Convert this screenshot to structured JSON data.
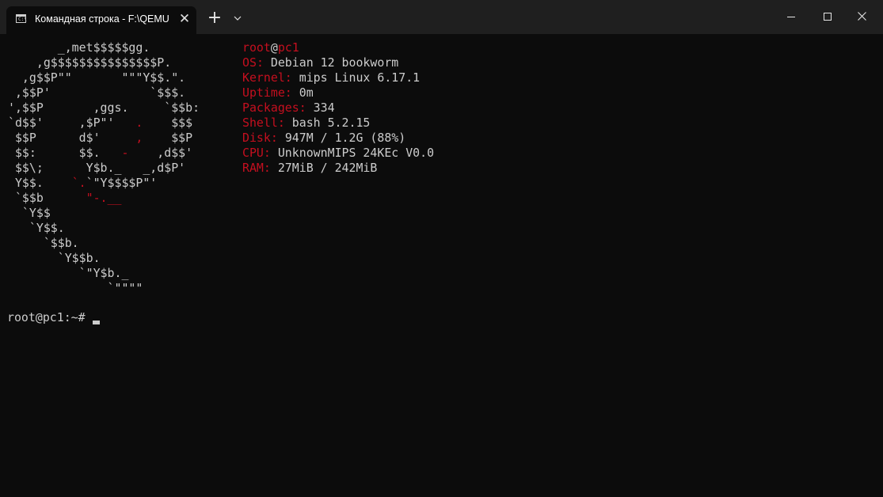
{
  "window": {
    "tab_title": "Командная строка - F:\\QEMU",
    "tab_icon_glyph": "C:\\",
    "tab_close": "✕",
    "new_tab": "+",
    "icons": [
      "terminal-icon",
      "close-icon",
      "plus-icon",
      "chevron-down-icon",
      "minimize-icon",
      "maximize-icon",
      "window-close-icon"
    ]
  },
  "colors": {
    "background": "#0c0c0c",
    "titlebar": "#1f1f1f",
    "text": "#cccccc",
    "accent_red": "#c50f1f"
  },
  "logo": {
    "lines": [
      [
        {
          "t": "       _,met$$$$$gg."
        }
      ],
      [
        {
          "t": "    ,g$$$$$$$$$$$$$$$P."
        }
      ],
      [
        {
          "t": "  ,g$$P\"\"       \"\"\"Y$$.\"."
        }
      ],
      [
        {
          "t": " ,$$P'              `$$$."
        }
      ],
      [
        {
          "t": "',$$P       ,ggs.     `$$b:"
        }
      ],
      [
        {
          "t": "`d$$'     ,$P\"'   "
        },
        {
          "t": ".",
          "r": true
        },
        {
          "t": "    $$$"
        }
      ],
      [
        {
          "t": " $$P      d$'     "
        },
        {
          "t": ",",
          "r": true
        },
        {
          "t": "    $$P"
        }
      ],
      [
        {
          "t": " $$:      $$.   "
        },
        {
          "t": "-",
          "r": true
        },
        {
          "t": "    ,d$$'"
        }
      ],
      [
        {
          "t": " $$\\;      Y$b._   _,d$P'"
        }
      ],
      [
        {
          "t": " Y$$.    "
        },
        {
          "t": "`.",
          "r": true
        },
        {
          "t": "`\"Y$$$$P\"'"
        }
      ],
      [
        {
          "t": " `$$b      "
        },
        {
          "t": "\"-.__",
          "r": true
        }
      ],
      [
        {
          "t": "  `Y$$"
        }
      ],
      [
        {
          "t": "   `Y$$."
        }
      ],
      [
        {
          "t": "     `$$b."
        }
      ],
      [
        {
          "t": "       `Y$$b."
        }
      ],
      [
        {
          "t": "          `\"Y$b._"
        }
      ],
      [
        {
          "t": "              `\"\"\"\""
        }
      ]
    ]
  },
  "sysinfo": {
    "user": "root",
    "at": "@",
    "host": "pc1",
    "rows": [
      {
        "key": "OS",
        "value": "Debian 12 bookworm"
      },
      {
        "key": "Kernel",
        "value": "mips Linux 6.17.1"
      },
      {
        "key": "Uptime",
        "value": "0m"
      },
      {
        "key": "Packages",
        "value": "334"
      },
      {
        "key": "Shell",
        "value": "bash 5.2.15"
      },
      {
        "key": "Disk",
        "value": "947M / 1.2G (88%)"
      },
      {
        "key": "CPU",
        "value": "UnknownMIPS 24KEc V0.0"
      },
      {
        "key": "RAM",
        "value": "27MiB / 242MiB"
      }
    ]
  },
  "prompt": "root@pc1:~#"
}
